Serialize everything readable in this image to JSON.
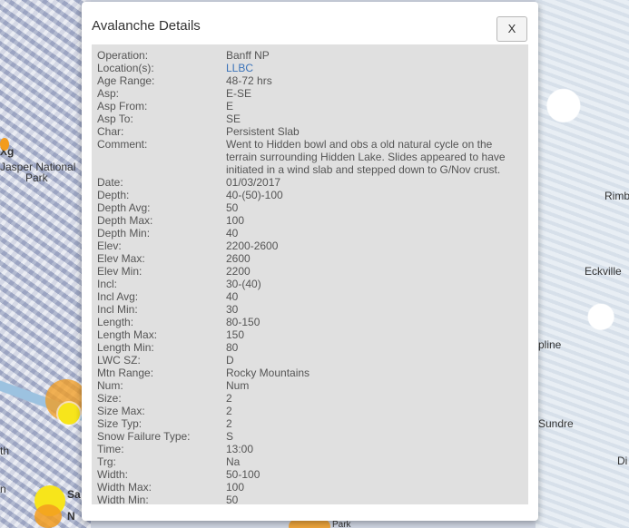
{
  "map": {
    "labels": [
      "Jasper National",
      "Park",
      "Rimb",
      "Eckville",
      "pline",
      "Sundre",
      "Di",
      "Sa",
      "N",
      "Park",
      "th",
      "n",
      "Xg"
    ]
  },
  "modal": {
    "title": "Avalanche Details",
    "close_label": "X",
    "rows": [
      {
        "key": "Operation:",
        "value": "Banff NP"
      },
      {
        "key": "Location(s):",
        "value": "LLBC"
      },
      {
        "key": "Age Range:",
        "value": "48-72 hrs"
      },
      {
        "key": "Asp:",
        "value": "E-SE"
      },
      {
        "key": "Asp From:",
        "value": "E"
      },
      {
        "key": "Asp To:",
        "value": "SE"
      },
      {
        "key": "Char:",
        "value": "Persistent Slab"
      },
      {
        "key": "Comment:",
        "value": "Went to Hidden bowl and obs a old natural cycle on the terrain surrounding Hidden Lake. Slides appeared to have initiated in a wind slab and stepped down to G/Nov crust."
      },
      {
        "key": "Date:",
        "value": "01/03/2017"
      },
      {
        "key": "Depth:",
        "value": "40-(50)-100"
      },
      {
        "key": "Depth Avg:",
        "value": "50"
      },
      {
        "key": "Depth Max:",
        "value": "100"
      },
      {
        "key": "Depth Min:",
        "value": "40"
      },
      {
        "key": "Elev:",
        "value": "2200-2600"
      },
      {
        "key": "Elev Max:",
        "value": "2600"
      },
      {
        "key": "Elev Min:",
        "value": "2200"
      },
      {
        "key": "Incl:",
        "value": "30-(40)"
      },
      {
        "key": "Incl Avg:",
        "value": "40"
      },
      {
        "key": "Incl Min:",
        "value": "30"
      },
      {
        "key": "Length:",
        "value": "80-150"
      },
      {
        "key": "Length Max:",
        "value": "150"
      },
      {
        "key": "Length Min:",
        "value": "80"
      },
      {
        "key": "LWC SZ:",
        "value": "D"
      },
      {
        "key": "Mtn Range:",
        "value": "Rocky Mountains"
      },
      {
        "key": "Num:",
        "value": "Num"
      },
      {
        "key": "Size:",
        "value": "2"
      },
      {
        "key": "Size Max:",
        "value": "2"
      },
      {
        "key": "Size Typ:",
        "value": "2"
      },
      {
        "key": "Snow Failure Type:",
        "value": "S"
      },
      {
        "key": "Time:",
        "value": "13:00"
      },
      {
        "key": "Trg:",
        "value": "Na"
      },
      {
        "key": "Width:",
        "value": "50-100"
      },
      {
        "key": "Width Max:",
        "value": "100"
      },
      {
        "key": "Width Min:",
        "value": "50"
      }
    ]
  }
}
